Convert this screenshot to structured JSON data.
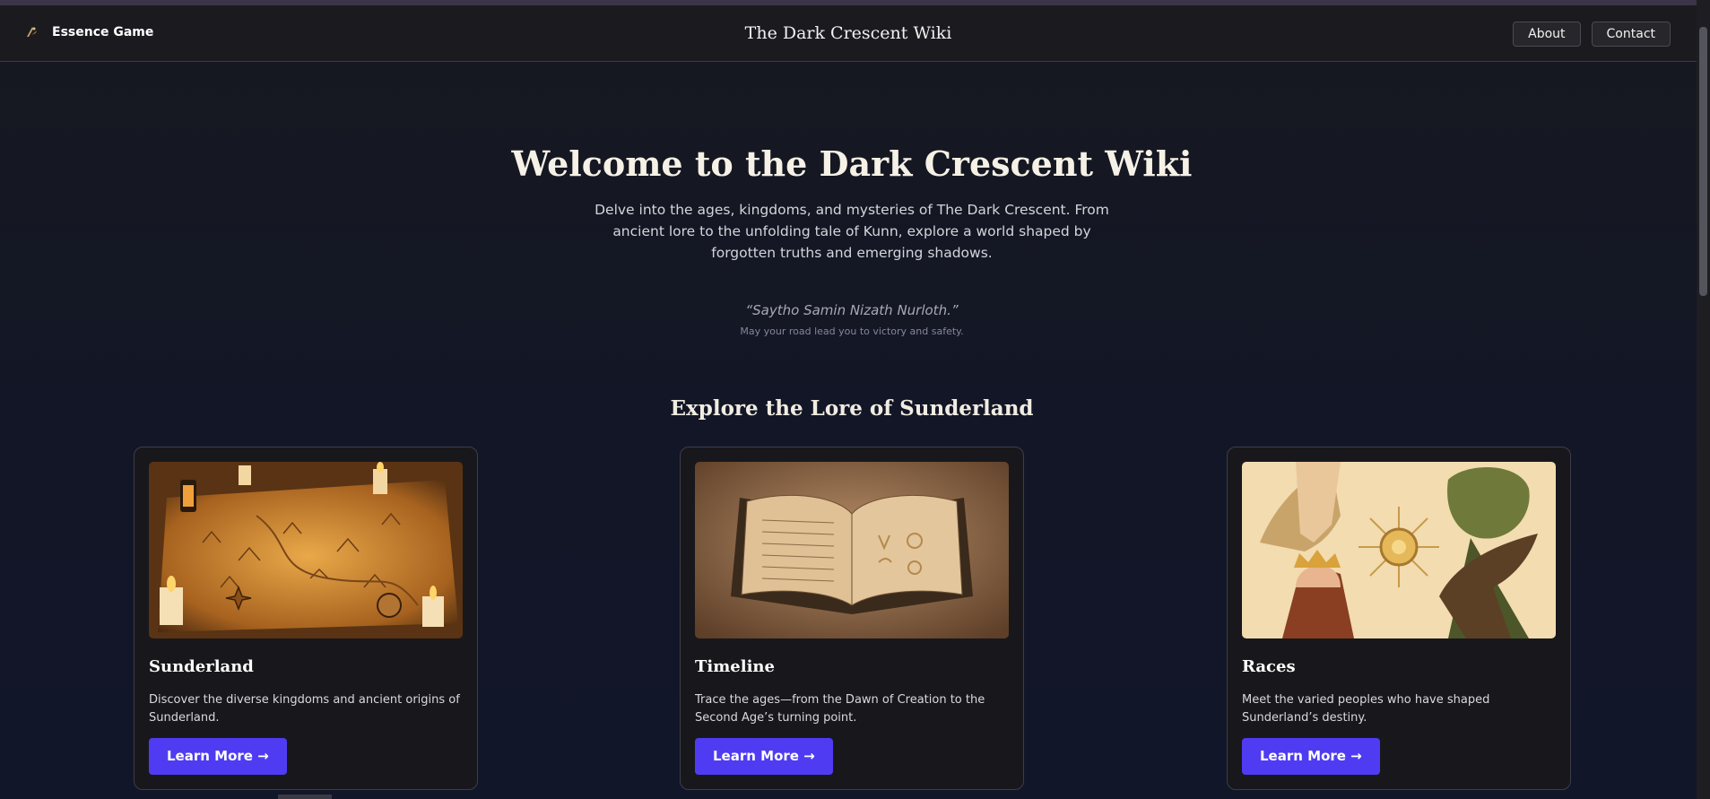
{
  "navbar": {
    "brand_name": "Essence Game",
    "brand_icon": "crescent-logo-icon",
    "site_title": "The Dark Crescent Wiki",
    "buttons": [
      {
        "label": "About"
      },
      {
        "label": "Contact"
      }
    ]
  },
  "hero": {
    "title": "Welcome to the Dark Crescent Wiki",
    "subtitle": "Delve into the ages, kingdoms, and mysteries of The Dark Crescent. From ancient lore to the unfolding tale of Kunn, explore a world shaped by forgotten truths and emerging shadows.",
    "quote": "“Saytho Samin Nizath Nurloth.”",
    "quote_translation": "May your road lead you to victory and safety."
  },
  "section": {
    "title": "Explore the Lore of Sunderland"
  },
  "cards": [
    {
      "title": "Sunderland",
      "description": "Discover the diverse kingdoms and ancient origins of Sunderland.",
      "button_label": "Learn More →",
      "image": "map-illustration"
    },
    {
      "title": "Timeline",
      "description": "Trace the ages—from the Dawn of Creation to the Second Age’s turning point.",
      "button_label": "Learn More →",
      "image": "open-book-illustration"
    },
    {
      "title": "Races",
      "description": "Meet the varied peoples who have shaped Sunderland’s destiny.",
      "button_label": "Learn More →",
      "image": "races-illustration"
    }
  ],
  "colors": {
    "accent": "#4f3cf2",
    "background": "#151722",
    "card": "#18181c"
  }
}
